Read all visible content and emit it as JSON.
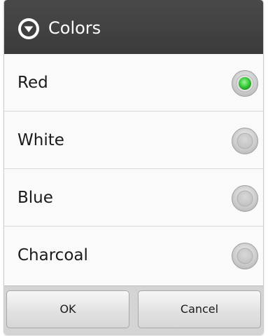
{
  "dialog": {
    "title": "Colors",
    "title_icon": "chevron-circle-icon",
    "selected_index": 0,
    "accent_color": "#3ccc3c",
    "items": [
      {
        "label": "Red",
        "selected": true
      },
      {
        "label": "White",
        "selected": false
      },
      {
        "label": "Blue",
        "selected": false
      },
      {
        "label": "Charcoal",
        "selected": false
      }
    ],
    "buttons": {
      "ok_label": "OK",
      "cancel_label": "Cancel"
    }
  }
}
